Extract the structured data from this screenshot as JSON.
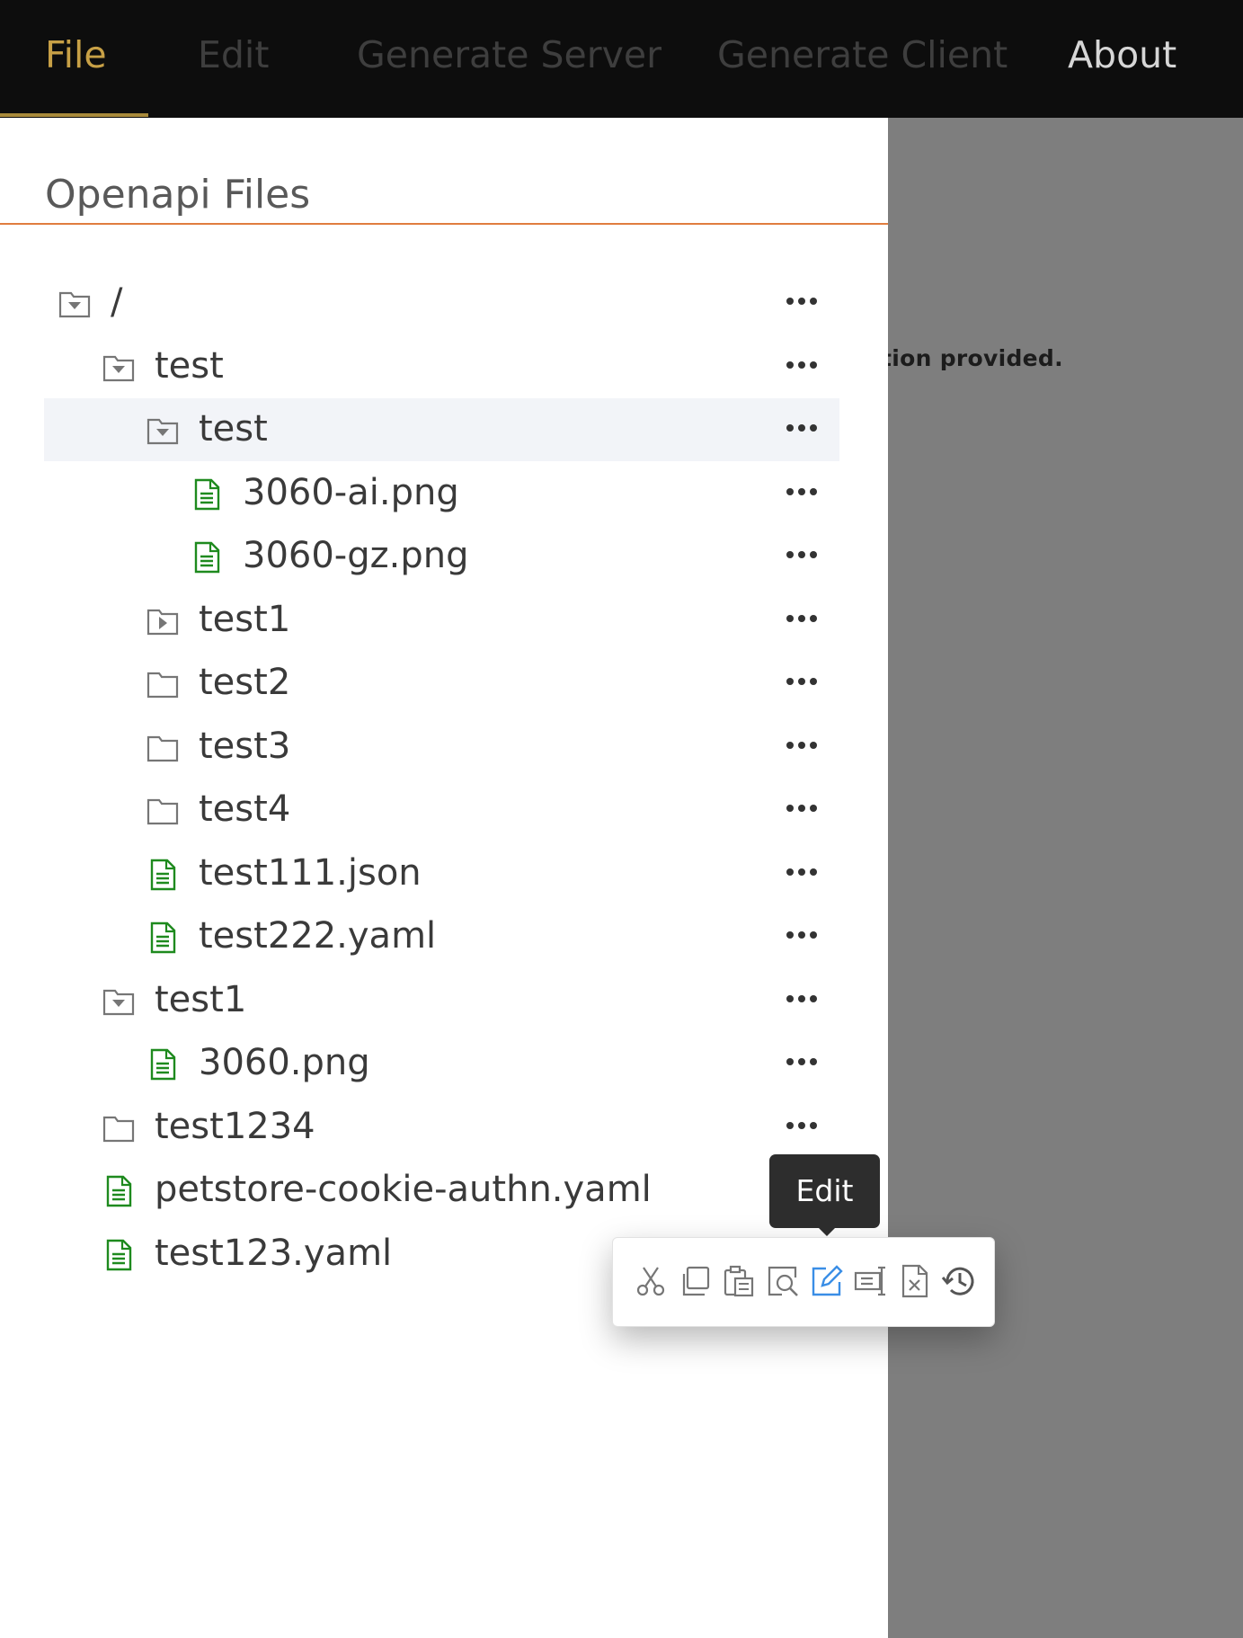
{
  "nav": {
    "tabs": [
      {
        "label": "File",
        "active": true
      },
      {
        "label": "Edit",
        "active": false
      },
      {
        "label": "Generate Server",
        "active": false
      },
      {
        "label": "Generate Client",
        "active": false
      },
      {
        "label": "About",
        "active": false
      }
    ]
  },
  "background": {
    "text": "tion provided."
  },
  "drawer": {
    "title": "Openapi Files",
    "tree": [
      {
        "label": "/",
        "icon": "folder-open-icon",
        "depth": 0
      },
      {
        "label": "test",
        "icon": "folder-open-icon",
        "depth": 1
      },
      {
        "label": "test",
        "icon": "folder-open-icon",
        "depth": 2,
        "selected": true
      },
      {
        "label": "3060-ai.png",
        "icon": "file-icon",
        "depth": 3
      },
      {
        "label": "3060-gz.png",
        "icon": "file-icon",
        "depth": 3
      },
      {
        "label": "test1",
        "icon": "folder-collapsed-icon",
        "depth": 2
      },
      {
        "label": "test2",
        "icon": "folder-icon",
        "depth": 2
      },
      {
        "label": "test3",
        "icon": "folder-icon",
        "depth": 2
      },
      {
        "label": "test4",
        "icon": "folder-icon",
        "depth": 2
      },
      {
        "label": "test111.json",
        "icon": "file-icon",
        "depth": 2
      },
      {
        "label": "test222.yaml",
        "icon": "file-icon",
        "depth": 2
      },
      {
        "label": "test1",
        "icon": "folder-open-icon",
        "depth": 1
      },
      {
        "label": "3060.png",
        "icon": "file-icon",
        "depth": 2
      },
      {
        "label": "test1234",
        "icon": "folder-icon",
        "depth": 1
      },
      {
        "label": "petstore-cookie-authn.yaml",
        "icon": "file-icon",
        "depth": 1
      },
      {
        "label": "test123.yaml",
        "icon": "file-icon",
        "depth": 1
      }
    ]
  },
  "popover": {
    "tooltip": "Edit",
    "actions": [
      {
        "icon": "cut-icon"
      },
      {
        "icon": "copy-icon"
      },
      {
        "icon": "paste-icon"
      },
      {
        "icon": "preview-icon"
      },
      {
        "icon": "edit-icon",
        "active": true
      },
      {
        "icon": "rename-icon"
      },
      {
        "icon": "delete-file-icon"
      },
      {
        "icon": "history-icon"
      }
    ]
  },
  "colors": {
    "accent": "#c7a046",
    "file_icon": "#1e8a1e",
    "edit_icon_active": "#3a8ee6",
    "divider": "#e07d3f"
  }
}
